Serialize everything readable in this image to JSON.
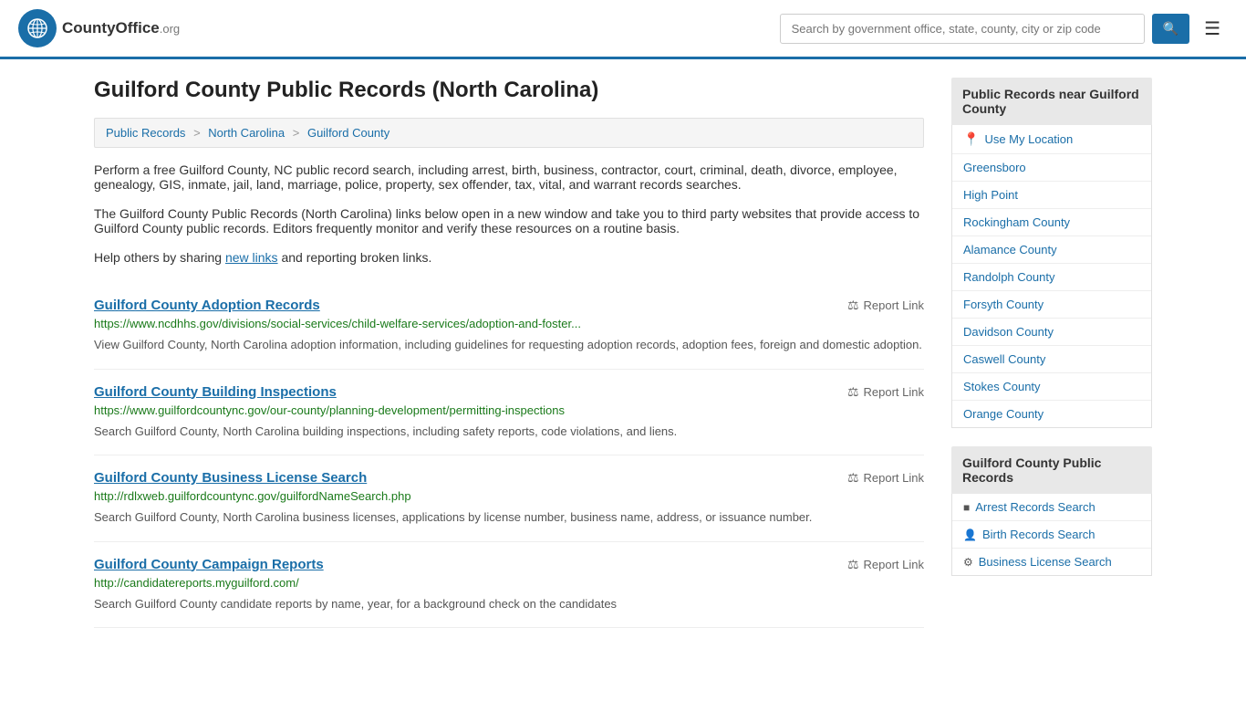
{
  "header": {
    "logo_text": "CountyOffice",
    "logo_org": ".org",
    "search_placeholder": "Search by government office, state, county, city or zip code",
    "search_value": ""
  },
  "page": {
    "title": "Guilford County Public Records (North Carolina)",
    "breadcrumbs": [
      {
        "label": "Public Records",
        "href": "#"
      },
      {
        "label": "North Carolina",
        "href": "#"
      },
      {
        "label": "Guilford County",
        "href": "#"
      }
    ],
    "intro1": "Perform a free Guilford County, NC public record search, including arrest, birth, business, contractor, court, criminal, death, divorce, employee, genealogy, GIS, inmate, jail, land, marriage, police, property, sex offender, tax, vital, and warrant records searches.",
    "intro2": "The Guilford County Public Records (North Carolina) links below open in a new window and take you to third party websites that provide access to Guilford County public records. Editors frequently monitor and verify these resources on a routine basis.",
    "share_text": "Help others by sharing",
    "share_link_text": "new links",
    "share_suffix": "and reporting broken links."
  },
  "records": [
    {
      "title": "Guilford County Adoption Records",
      "url": "https://www.ncdhhs.gov/divisions/social-services/child-welfare-services/adoption-and-foster...",
      "description": "View Guilford County, North Carolina adoption information, including guidelines for requesting adoption records, adoption fees, foreign and domestic adoption."
    },
    {
      "title": "Guilford County Building Inspections",
      "url": "https://www.guilfordcountync.gov/our-county/planning-development/permitting-inspections",
      "description": "Search Guilford County, North Carolina building inspections, including safety reports, code violations, and liens."
    },
    {
      "title": "Guilford County Business License Search",
      "url": "http://rdlxweb.guilfordcountync.gov/guilfordNameSearch.php",
      "description": "Search Guilford County, North Carolina business licenses, applications by license number, business name, address, or issuance number."
    },
    {
      "title": "Guilford County Campaign Reports",
      "url": "http://candidatereports.myguilford.com/",
      "description": "Search Guilford County candidate reports by name, year, for a background check on the candidates"
    }
  ],
  "report_link_label": "Report Link",
  "sidebar": {
    "nearby_heading": "Public Records near Guilford County",
    "use_location_label": "Use My Location",
    "nearby_places": [
      "Greensboro",
      "High Point",
      "Rockingham County",
      "Alamance County",
      "Randolph County",
      "Forsyth County",
      "Davidson County",
      "Caswell County",
      "Stokes County",
      "Orange County"
    ],
    "guilford_heading": "Guilford County Public Records",
    "guilford_records": [
      {
        "label": "Arrest Records Search",
        "icon": "square"
      },
      {
        "label": "Birth Records Search",
        "icon": "person"
      },
      {
        "label": "Business License Search",
        "icon": "gear"
      }
    ]
  }
}
